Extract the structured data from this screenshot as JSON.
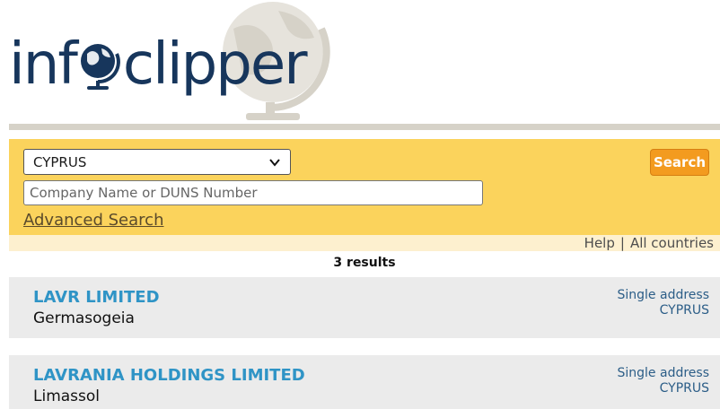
{
  "logo": {
    "part1": "inf",
    "part2": "clipper"
  },
  "search": {
    "country_selected": "CYPRUS",
    "company_placeholder": "Company Name or DUNS Number",
    "advanced_label": "Advanced Search",
    "button_label": "Search"
  },
  "links": {
    "help": "Help",
    "separator": "|",
    "all_countries": "All countries"
  },
  "results": {
    "count_label": "3 results",
    "items": [
      {
        "name": "LAVR LIMITED",
        "city": "Germasogeia",
        "address_type": "Single address",
        "country": "CYPRUS"
      },
      {
        "name": "LAVRANIA HOLDINGS LIMITED",
        "city": "Limassol",
        "address_type": "Single address",
        "country": "CYPRUS"
      }
    ]
  },
  "colors": {
    "brand_navy": "#17365c",
    "accent_orange": "#f39b1f",
    "panel_yellow": "#fbd35c",
    "link_blue": "#2f94c6"
  }
}
